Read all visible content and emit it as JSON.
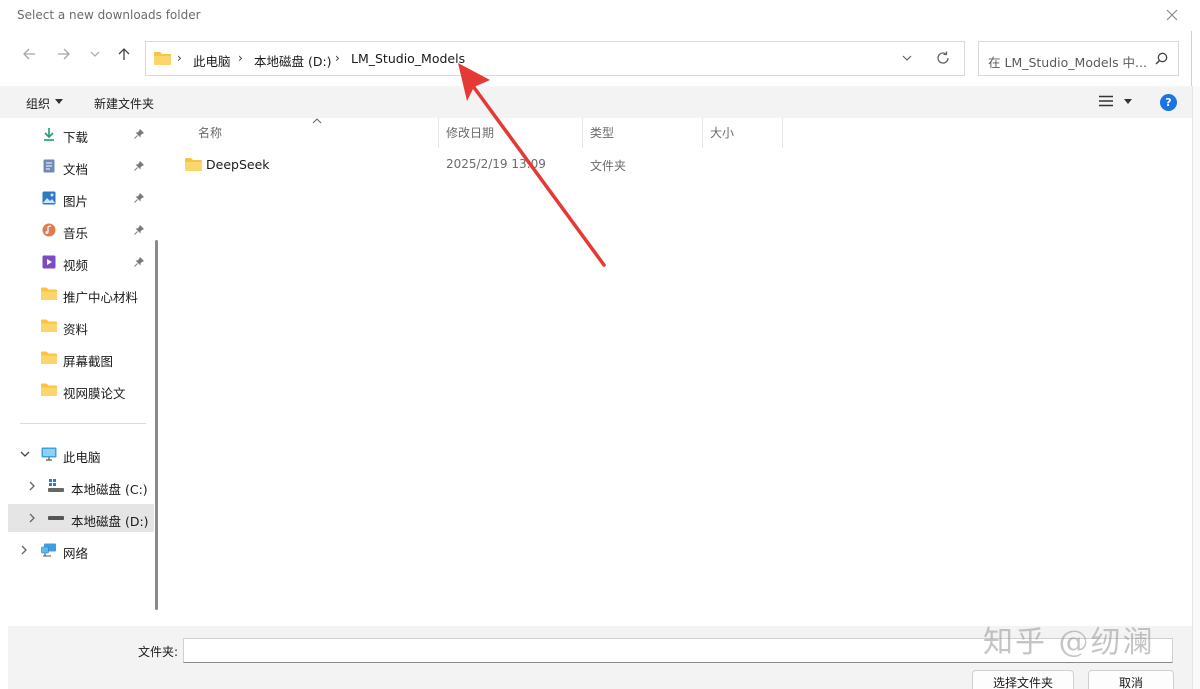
{
  "window": {
    "title": "Select a new downloads folder"
  },
  "address_bar": {
    "crumbs": [
      "此电脑",
      "本地磁盘 (D:)",
      "LM_Studio_Models"
    ]
  },
  "search": {
    "placeholder": "在 LM_Studio_Models 中..."
  },
  "toolbar": {
    "organize_label": "组织",
    "new_folder_label": "新建文件夹",
    "help_label": "?"
  },
  "sidebar": {
    "quick_access": [
      {
        "label": "下载",
        "icon": "download-icon"
      },
      {
        "label": "文档",
        "icon": "document-icon"
      },
      {
        "label": "图片",
        "icon": "picture-icon"
      },
      {
        "label": "音乐",
        "icon": "music-icon"
      },
      {
        "label": "视频",
        "icon": "video-icon"
      },
      {
        "label": "推广中心材料",
        "icon": "folder-icon"
      },
      {
        "label": "资料",
        "icon": "folder-icon"
      },
      {
        "label": "屏幕截图",
        "icon": "folder-icon"
      },
      {
        "label": "视网膜论文",
        "icon": "folder-icon"
      }
    ],
    "this_pc": {
      "label": "此电脑",
      "icon": "computer-icon"
    },
    "drives": [
      {
        "label": "本地磁盘 (C:)",
        "icon": "windows-drive-icon"
      },
      {
        "label": "本地磁盘 (D:)",
        "icon": "drive-icon",
        "selected": true
      }
    ],
    "network": {
      "label": "网络",
      "icon": "network-icon"
    }
  },
  "columns": {
    "name": "名称",
    "date": "修改日期",
    "type": "类型",
    "size": "大小"
  },
  "files": [
    {
      "name": "DeepSeek",
      "date": "2025/2/19 13:09",
      "type": "文件夹",
      "size": ""
    }
  ],
  "footer": {
    "folder_label": "文件夹:",
    "folder_value": "",
    "select_button": "选择文件夹",
    "cancel_button": "取消"
  },
  "overlay": {
    "watermark": "知乎 @纫澜"
  },
  "colors": {
    "accent": "#1a73e8",
    "folder": "#f8c542",
    "annotation_arrow": "#e53935",
    "selection": "#e5e5e5"
  }
}
